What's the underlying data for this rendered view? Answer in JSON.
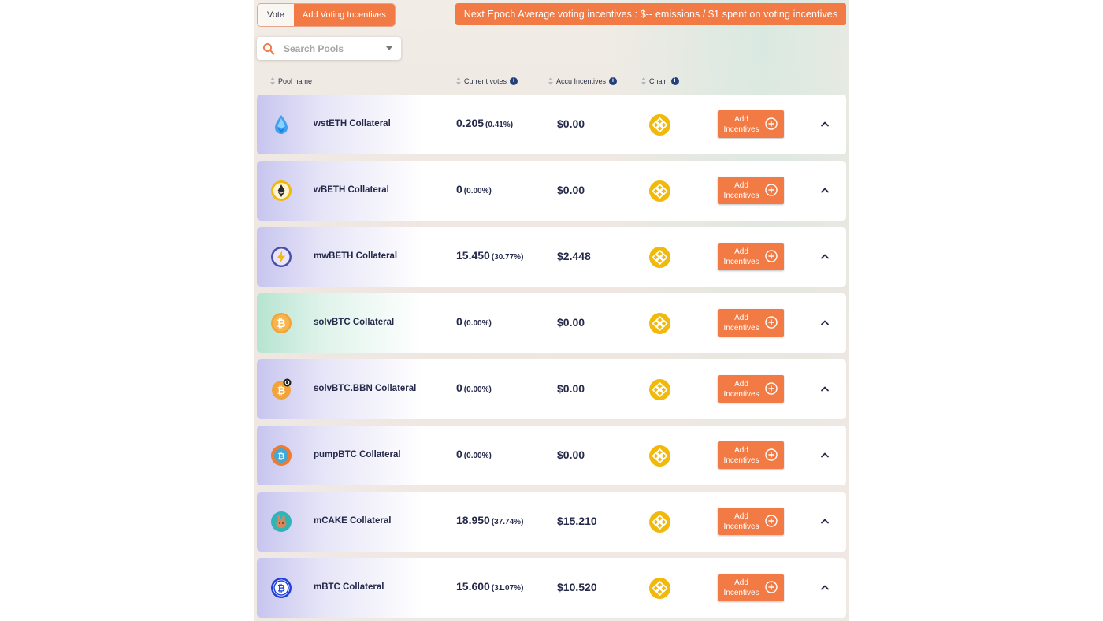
{
  "tabs": [
    {
      "label": "Vote"
    },
    {
      "label": "Add Voting Incentives"
    }
  ],
  "banner": {
    "text": "Next Epoch Average voting incentives : $-- emissions / $1 spent on voting incentives"
  },
  "search": {
    "placeholder": "Search Pools"
  },
  "columns": {
    "pool_name": "Pool name",
    "current_votes": "Current votes",
    "accu_incentives": "Accu Incentives",
    "chain": "Chain"
  },
  "colors": {
    "accent": "#f27a45",
    "text": "#24294a",
    "chain_badge": "#f0b90b"
  },
  "pools": [
    {
      "name": "wstETH Collateral",
      "votes": "0.205",
      "pct": "(0.41%)",
      "accu": "$0.00",
      "icon": "wsteth-icon",
      "button": "Add Incentives"
    },
    {
      "name": "wBETH Collateral",
      "votes": "0",
      "pct": "(0.00%)",
      "accu": "$0.00",
      "icon": "wbeth-icon",
      "button": "Add Incentives"
    },
    {
      "name": "mwBETH Collateral",
      "votes": "15.450",
      "pct": "(30.77%)",
      "accu": "$2.448",
      "icon": "mwbeth-icon",
      "button": "Add Incentives"
    },
    {
      "name": "solvBTC Collateral",
      "votes": "0",
      "pct": "(0.00%)",
      "accu": "$0.00",
      "icon": "solvbtc-icon",
      "button": "Add Incentives"
    },
    {
      "name": "solvBTC.BBN Collateral",
      "votes": "0",
      "pct": "(0.00%)",
      "accu": "$0.00",
      "icon": "solvbtc-bbn-icon",
      "button": "Add Incentives"
    },
    {
      "name": "pumpBTC Collateral",
      "votes": "0",
      "pct": "(0.00%)",
      "accu": "$0.00",
      "icon": "pumpbtc-icon",
      "button": "Add Incentives"
    },
    {
      "name": "mCAKE Collateral",
      "votes": "18.950",
      "pct": "(37.74%)",
      "accu": "$15.210",
      "icon": "mcake-icon",
      "button": "Add Incentives"
    },
    {
      "name": "mBTC Collateral",
      "votes": "15.600",
      "pct": "(31.07%)",
      "accu": "$10.520",
      "icon": "mbtc-icon",
      "button": "Add Incentives"
    }
  ]
}
